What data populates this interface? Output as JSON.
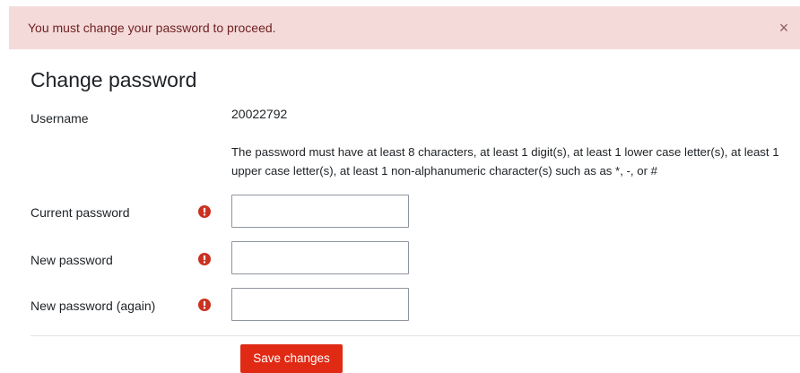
{
  "alert": {
    "message": "You must change your password to proceed.",
    "close_glyph": "×"
  },
  "page": {
    "title": "Change password"
  },
  "form": {
    "username": {
      "label": "Username",
      "value": "20022792"
    },
    "password_policy": "The password must have at least 8 characters, at least 1 digit(s), at least 1 lower case letter(s), at least 1 upper case letter(s), at least 1 non-alphanumeric character(s) such as as *, -, or #",
    "current_password": {
      "label": "Current password",
      "value": ""
    },
    "new_password": {
      "label": "New password",
      "value": ""
    },
    "new_password_again": {
      "label": "New password (again)",
      "value": ""
    },
    "required_icon": "exclamation-circle-icon",
    "save_label": "Save changes"
  },
  "colors": {
    "alert_background": "#f5dada",
    "alert_text": "#6e1f1f",
    "required_icon": "#ca3120",
    "save_button": "#e02a14"
  }
}
